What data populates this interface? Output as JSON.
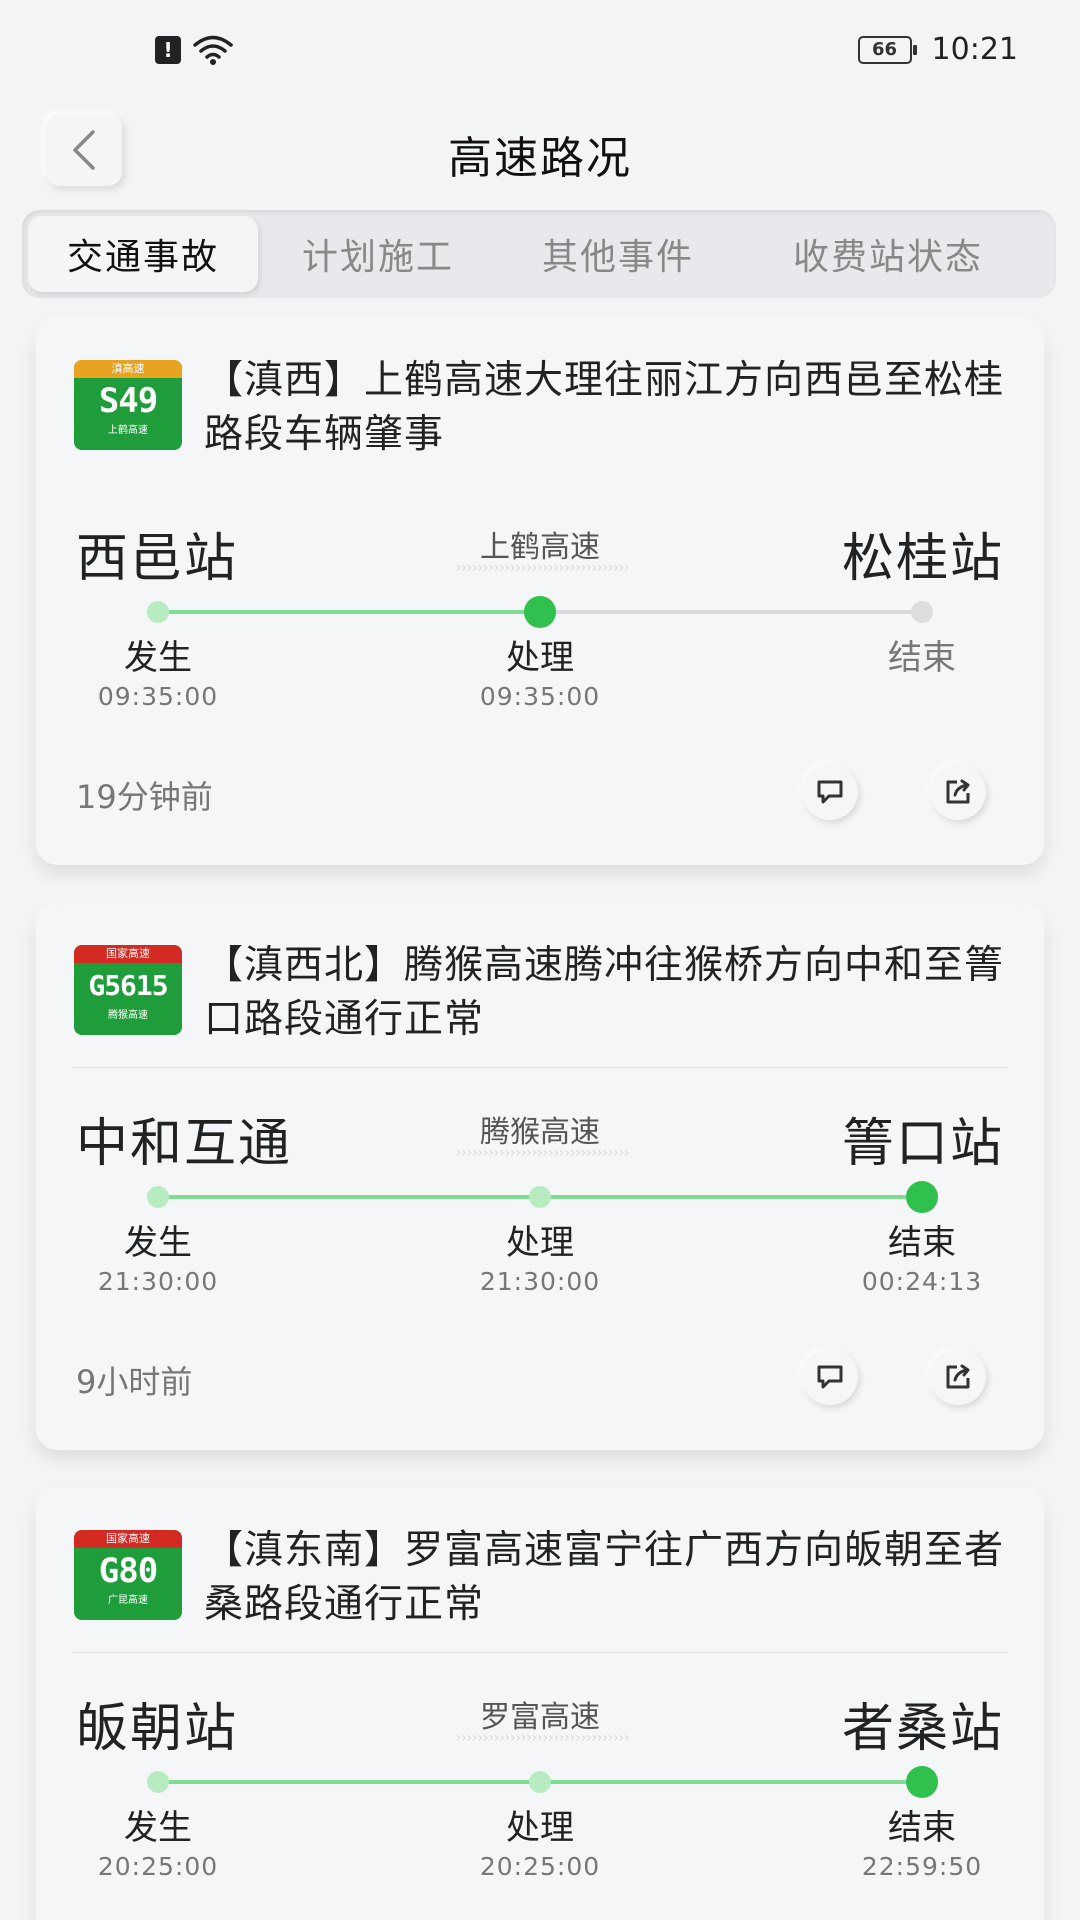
{
  "status_bar": {
    "sim_glyph": "!",
    "battery": "66",
    "time": "10:21",
    "icons": [
      "sim-alert-icon",
      "wifi-icon",
      "battery-icon"
    ]
  },
  "header": {
    "title": "高速路况",
    "back_icon": "chevron-left-icon"
  },
  "tabs": [
    "交通事故",
    "计划施工",
    "其他事件",
    "收费站状态"
  ],
  "active_tab": "交通事故",
  "stage_labels": {
    "occur": "发生",
    "handle": "处理",
    "end": "结束"
  },
  "colors": {
    "accent_green": "#2fc04d",
    "track_green": "#7fdc92",
    "provincial_badge": "#e8a321",
    "national_badge": "#d42a24",
    "badge_green": "#1f9d3a"
  },
  "incidents": [
    {
      "badge": {
        "top": "滇高速",
        "code": "S49",
        "bottom": "上鹤高速",
        "type": "provincial"
      },
      "title": "【滇西】上鹤高速大理往丽江方向西邑至松桂路段车辆肇事",
      "from": "西邑站",
      "to": "松桂站",
      "road": "上鹤高速",
      "occur_time": "09:35:00",
      "handle_time": "09:35:00",
      "end_time": "",
      "progress_stage": "处理",
      "ago": "19分钟前"
    },
    {
      "badge": {
        "top": "国家高速",
        "code": "G5615",
        "bottom": "腾猴高速",
        "type": "national"
      },
      "title": "【滇西北】腾猴高速腾冲往猴桥方向中和至箐口路段通行正常",
      "from": "中和互通",
      "to": "箐口站",
      "road": "腾猴高速",
      "occur_time": "21:30:00",
      "handle_time": "21:30:00",
      "end_time": "00:24:13",
      "progress_stage": "结束",
      "ago": "9小时前"
    },
    {
      "badge": {
        "top": "国家高速",
        "code": "G80",
        "bottom": "广昆高速",
        "type": "national"
      },
      "title": "【滇东南】罗富高速富宁往广西方向皈朝至者桑路段通行正常",
      "from": "皈朝站",
      "to": "者桑站",
      "road": "罗富高速",
      "occur_time": "20:25:00",
      "handle_time": "20:25:00",
      "end_time": "22:59:50",
      "progress_stage": "结束",
      "ago": ""
    }
  ],
  "actions": {
    "comment_icon": "comment-icon",
    "share_icon": "share-icon"
  }
}
